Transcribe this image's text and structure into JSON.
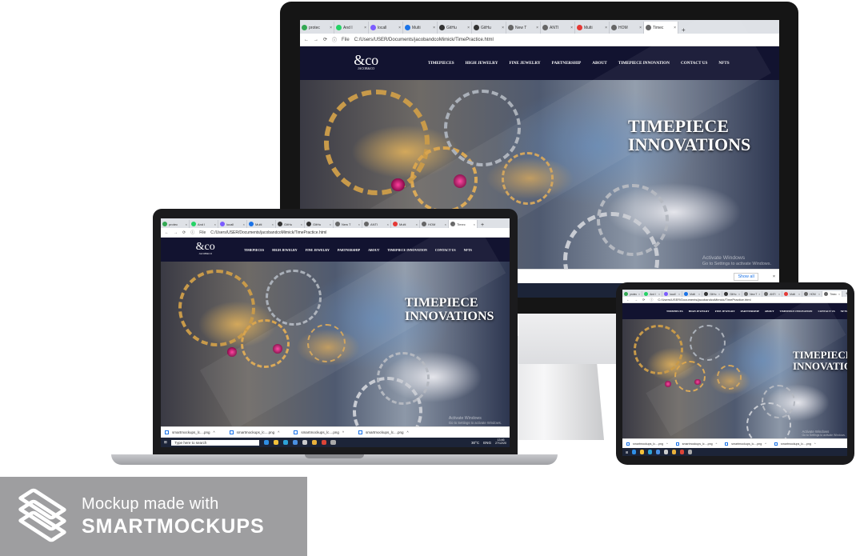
{
  "browser": {
    "tabs": [
      {
        "label": "protec",
        "icon": "shield-icon",
        "color": "#34a853"
      },
      {
        "label": "And I",
        "icon": "whatsapp-icon",
        "color": "#25d366"
      },
      {
        "label": "locall",
        "icon": "php-icon",
        "color": "#7b5cff"
      },
      {
        "label": "Multi",
        "icon": "cloud-icon",
        "color": "#1a73e8"
      },
      {
        "label": "GitHu",
        "icon": "github-icon",
        "color": "#333333"
      },
      {
        "label": "GitHu",
        "icon": "github-icon",
        "color": "#333333"
      },
      {
        "label": "New T",
        "icon": "globe-icon",
        "color": "#666666"
      },
      {
        "label": "ANTI",
        "icon": "globe-icon",
        "color": "#666666"
      },
      {
        "label": "Multi",
        "icon": "ring-icon",
        "color": "#e53935"
      },
      {
        "label": "HOM",
        "icon": "globe-icon",
        "color": "#666666"
      },
      {
        "label": "Timec",
        "icon": "globe-icon",
        "color": "#666666",
        "active": true
      }
    ],
    "address": {
      "prefix": "File",
      "url": "C:/Users/USER/Documents/jacobandcoMimick/TimePractice.html"
    }
  },
  "site": {
    "logo_mark": "&co",
    "logo_sub": "JACOB&CO",
    "nav": [
      "TIMEPIECES",
      "HIGH JEWELRY",
      "FINE JEWELRY",
      "PARTNERSHIP",
      "ABOUT",
      "TIMEPIECE INNOVATION",
      "CONTACT US",
      "NFTS"
    ],
    "hero_title_line1": "TIMEPIECE",
    "hero_title_line2": "INNOVATIONS",
    "hero_title_line2_tablet": "INNOVATIO"
  },
  "windows": {
    "activate_title": "Activate Windows",
    "activate_sub": "Go to Settings to activate Windows."
  },
  "downloads": {
    "items": [
      "smartmockups_lc....png",
      "smartmockups_lc....png",
      "smartmockups_lc....png",
      "smartmockups_lc....png"
    ],
    "monitor_items": [
      ".png",
      "smartmockups_lc....png"
    ],
    "show_all": "Show all"
  },
  "taskbar": {
    "search_placeholder": "Type here to search",
    "weather": "30°C",
    "lang": "ENG",
    "time_laptop": "13:46",
    "date_laptop": "27/12/20",
    "time_monitor": "13:46"
  },
  "badge": {
    "line1": "Mockup made with",
    "line2": "SMARTMOCKUPS"
  },
  "colors": {
    "accent": "#1a73e8",
    "site_bg": "#121330",
    "badge_bg": "#9e9ea0"
  }
}
